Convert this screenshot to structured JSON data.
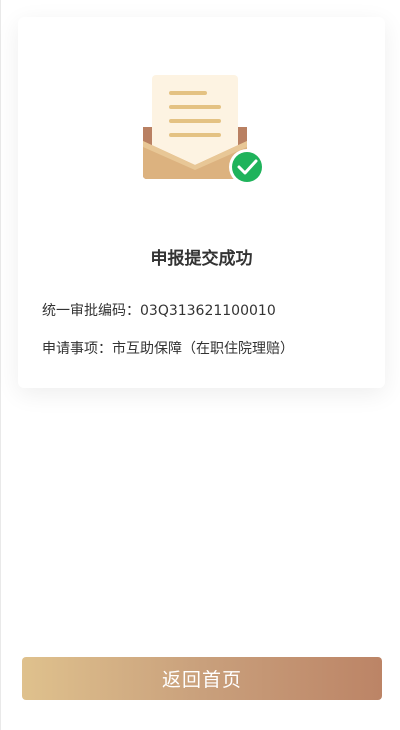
{
  "result": {
    "title": "申报提交成功",
    "approval_code_label": "统一审批编码：",
    "approval_code_value": "03Q313621100010",
    "item_label": "申请事项：",
    "item_value": "市互助保障（在职住院理赔）"
  },
  "icons": {
    "illustration": "envelope-letter-icon",
    "status": "check-circle-icon"
  },
  "colors": {
    "success_green": "#1fb35b",
    "button_gradient_start": "#dfc18d",
    "button_gradient_end": "#bc8466"
  },
  "footer": {
    "home_button_label": "返回首页"
  }
}
